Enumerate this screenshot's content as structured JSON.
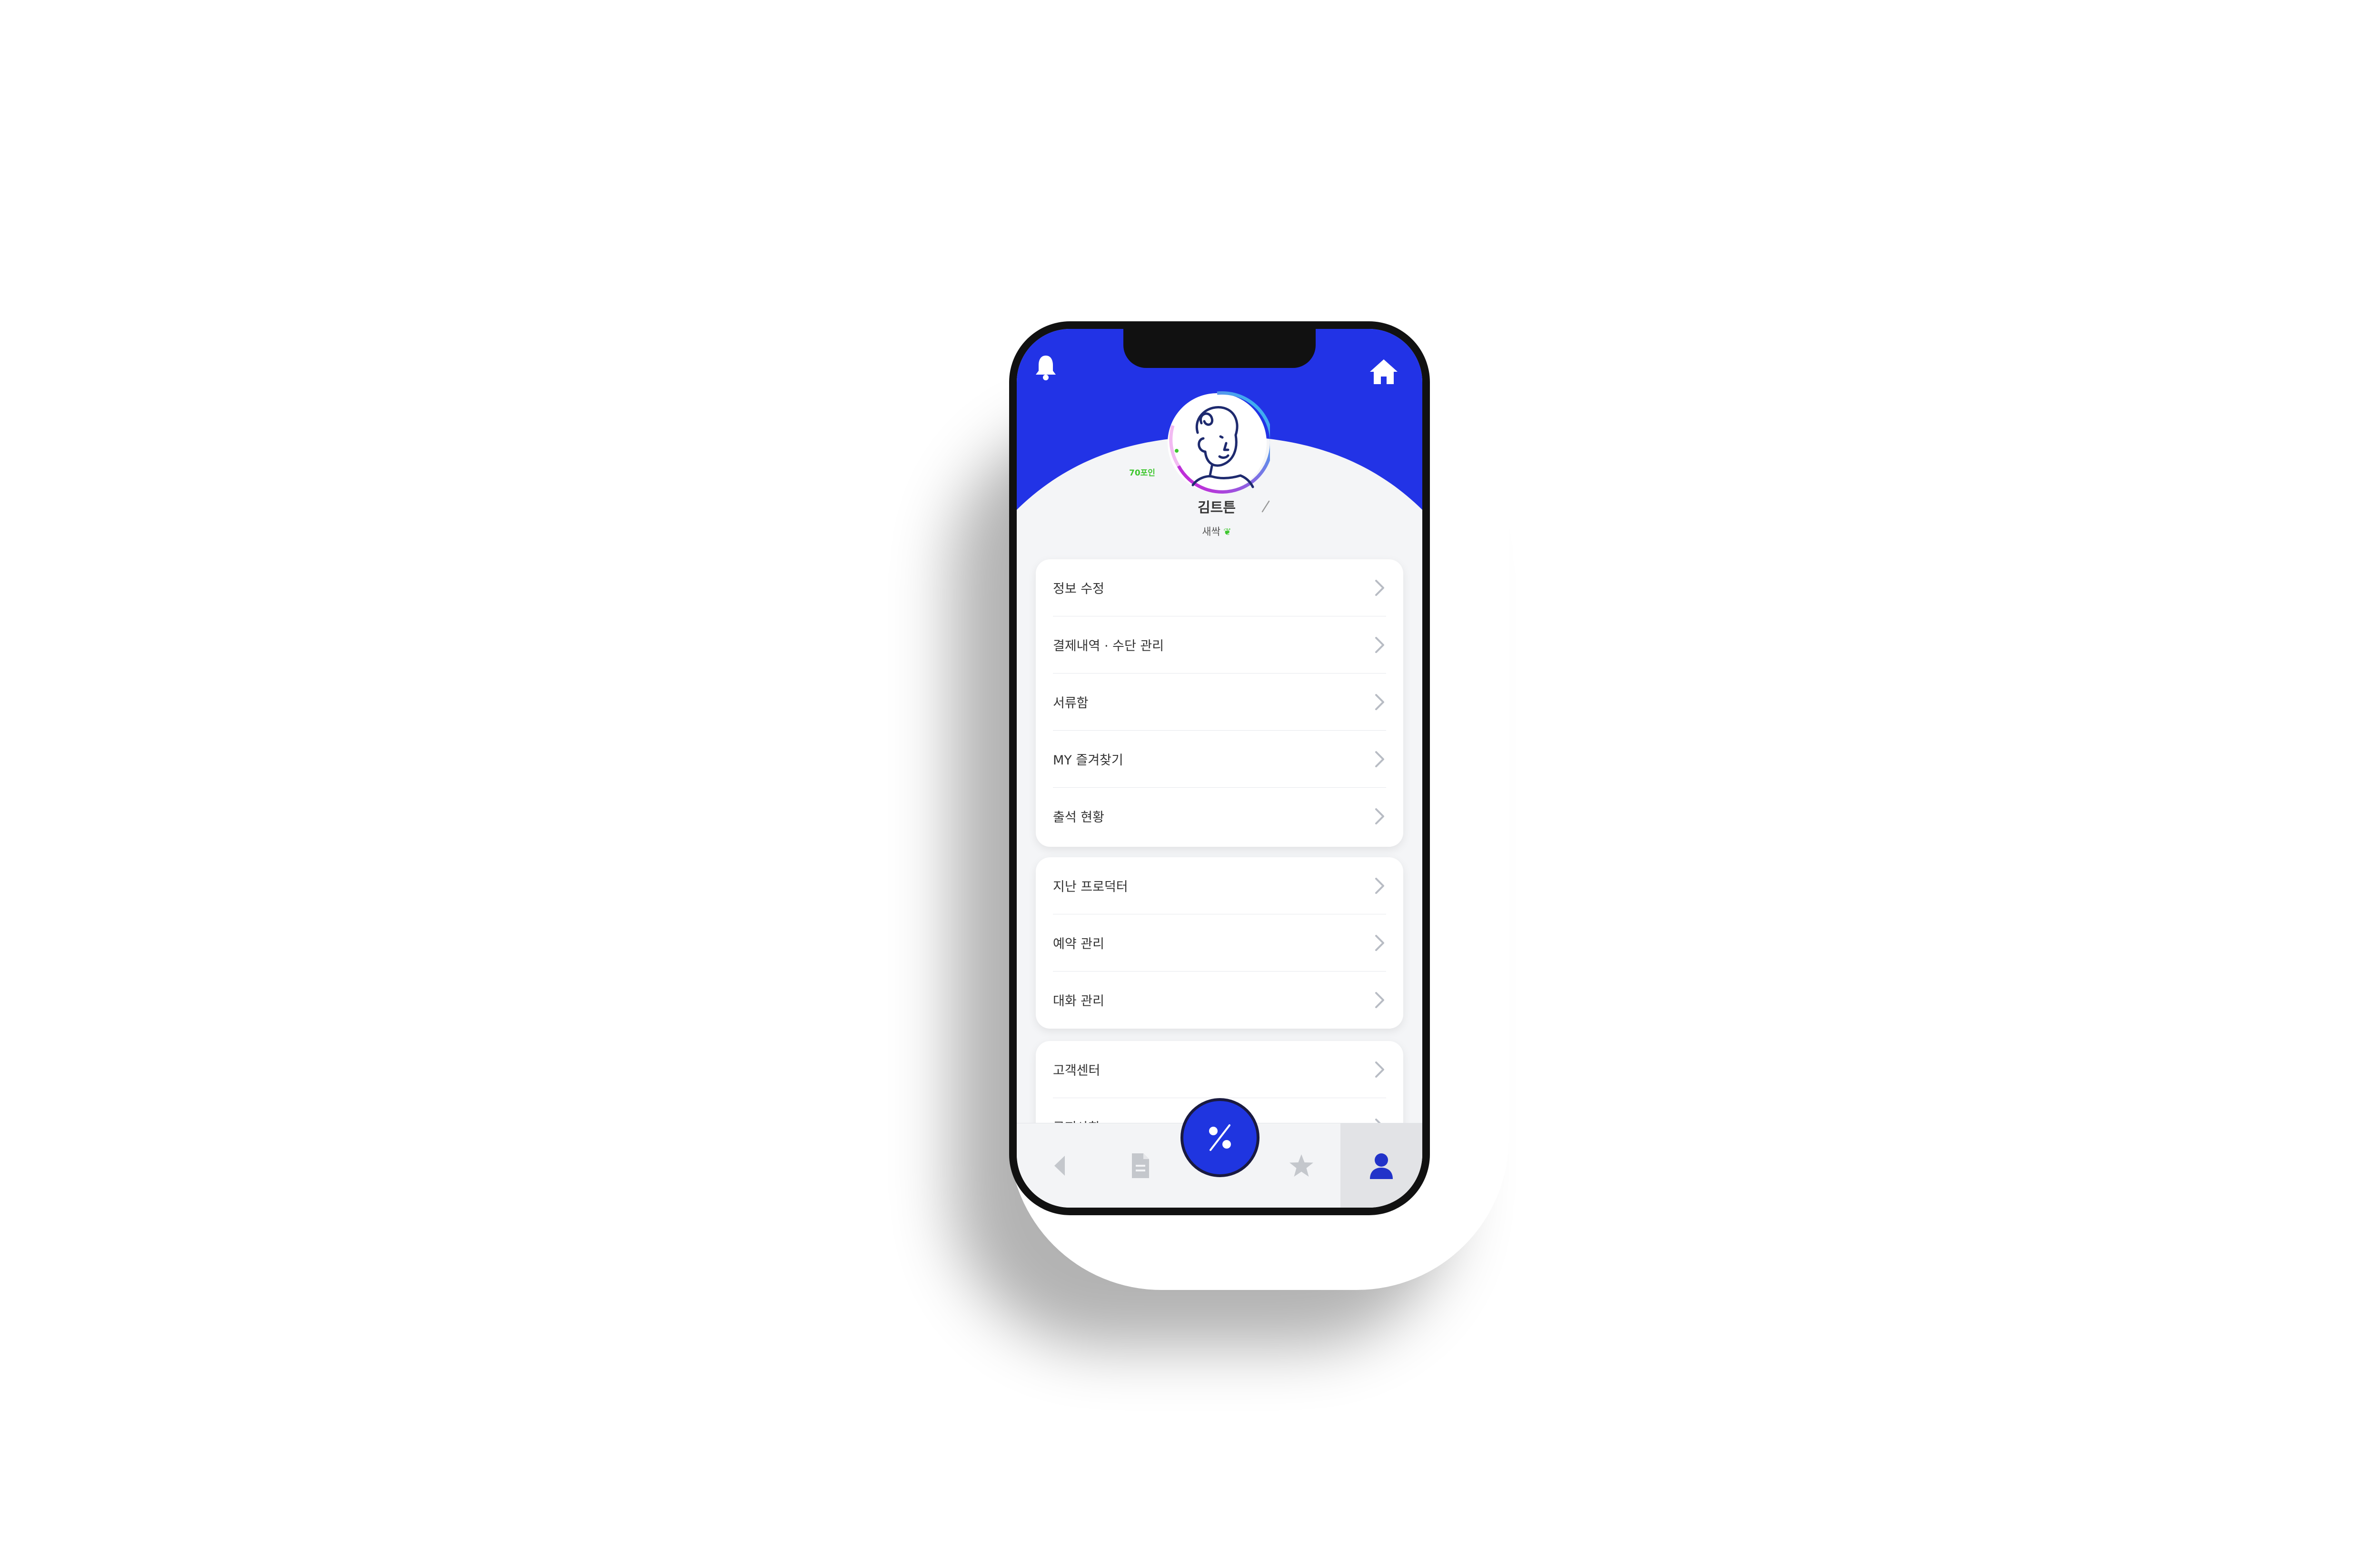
{
  "header": {
    "bell_icon": "bell-icon",
    "home_icon": "home-icon",
    "brand_color": "#2233e6"
  },
  "profile": {
    "points": "70포인",
    "name": "김트튼",
    "grade": "새싹",
    "grade_icon": "sprout-icon",
    "edit_icon": "pencil-icon"
  },
  "menu_groups": [
    {
      "items": [
        "정보 수정",
        "결제내역 · 수단 관리",
        "서류함",
        "MY 즐겨찾기",
        "출석 현황"
      ]
    },
    {
      "items": [
        "지난 프로덕터",
        "예약 관리",
        "대화 관리"
      ]
    },
    {
      "items": [
        "고객센터",
        "공지사항"
      ]
    }
  ],
  "tabbar": {
    "items": [
      "back-icon",
      "document-icon",
      "percent-icon",
      "star-icon",
      "profile-icon"
    ],
    "active": "profile-icon",
    "fab_color": "#1f35e0"
  }
}
